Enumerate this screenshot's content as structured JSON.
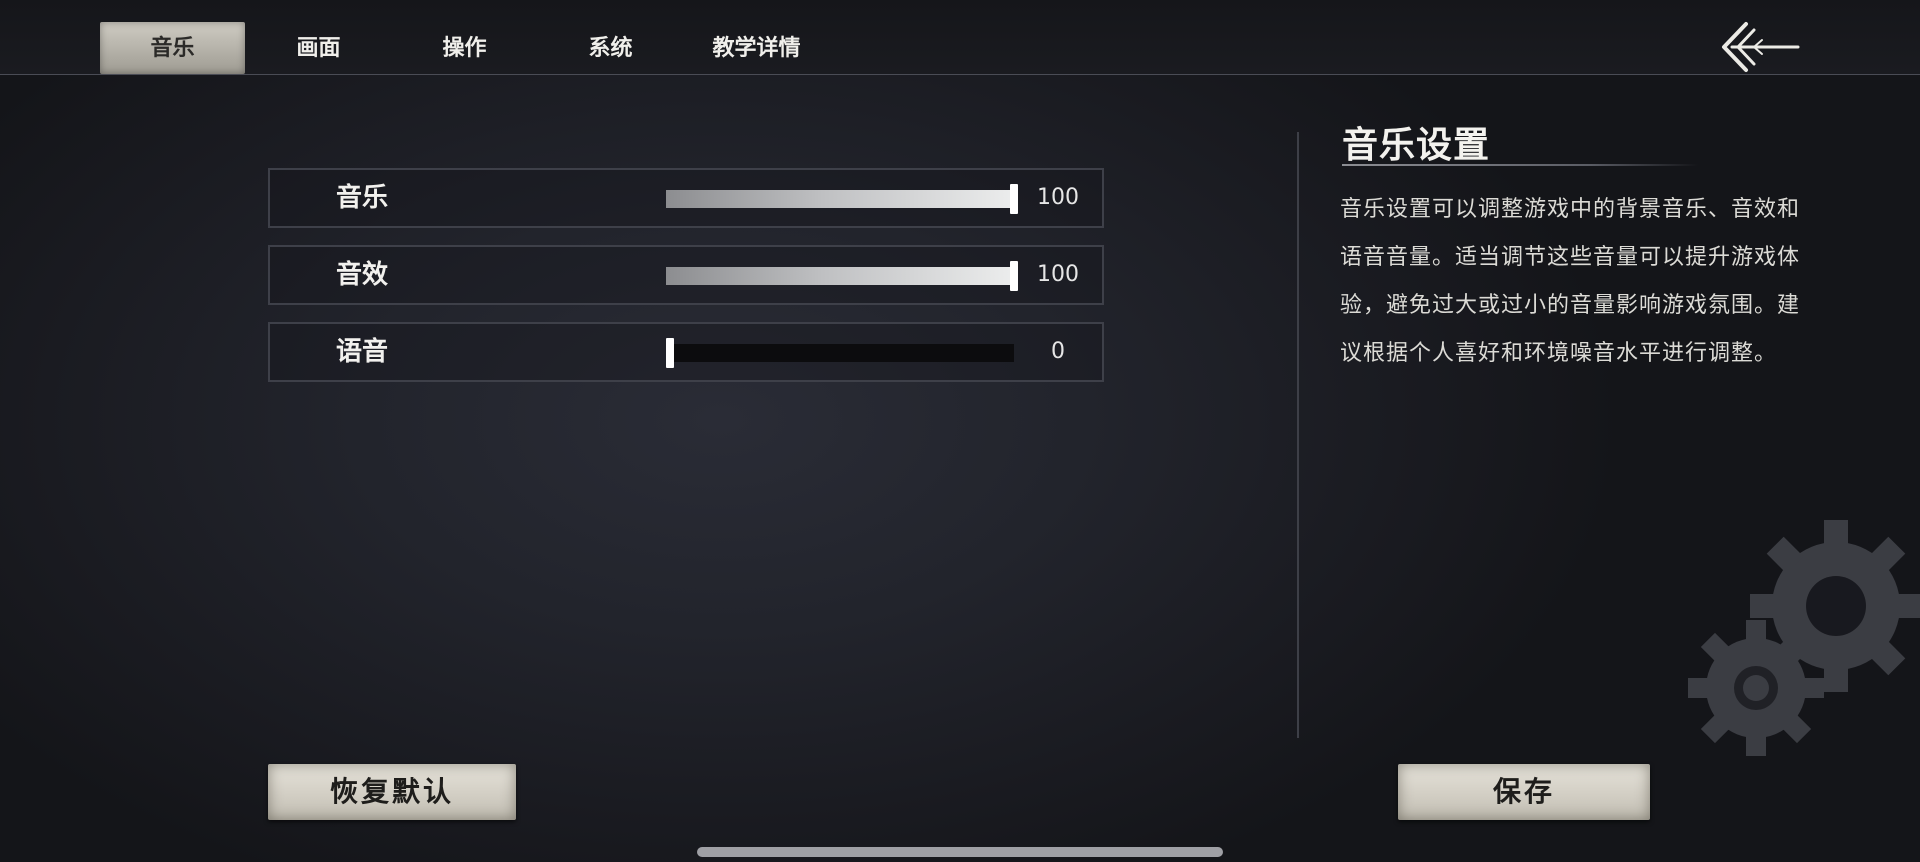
{
  "tabs": [
    {
      "label": "音乐",
      "active": true
    },
    {
      "label": "画面",
      "active": false
    },
    {
      "label": "操作",
      "active": false
    },
    {
      "label": "系统",
      "active": false
    },
    {
      "label": "教学详情",
      "active": false
    }
  ],
  "back_icon": "arrow-left-icon",
  "settings": [
    {
      "label": "音乐",
      "value": "100",
      "percent": 100
    },
    {
      "label": "音效",
      "value": "100",
      "percent": 100
    },
    {
      "label": "语音",
      "value": "0",
      "percent": 0
    }
  ],
  "info": {
    "title": "音乐设置",
    "body": "音乐设置可以调整游戏中的背景音乐、音效和语音音量。适当调节这些音量可以提升游戏体验，避免过大或过小的音量影响游戏氛围。建议根据个人喜好和环境噪音水平进行调整。"
  },
  "decoration_icon": "gears-icon",
  "buttons": {
    "reset_label": "恢复默认",
    "save_label": "保存"
  }
}
